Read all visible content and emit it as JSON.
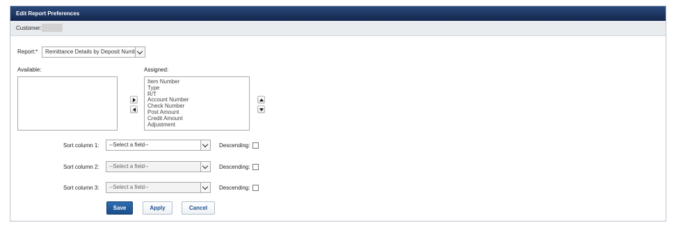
{
  "panel": {
    "title": "Edit Report Preferences"
  },
  "customer": {
    "label": "Customer:"
  },
  "report": {
    "label": "Report:*",
    "selected": "Remittance Details by Deposit Number"
  },
  "available": {
    "label": "Available:",
    "items": []
  },
  "assigned": {
    "label": "Assigned:",
    "items": [
      "Item Number",
      "Type",
      "R/T",
      "Account Number",
      "Check Number",
      "Post Amount",
      "Credit Amount",
      "Adjustment"
    ]
  },
  "sort": {
    "rows": [
      {
        "label": "Sort column 1:",
        "placeholder": "--Select a field--",
        "descending_label": "Descending:",
        "enabled": true
      },
      {
        "label": "Sort column 2:",
        "placeholder": "--Select a field--",
        "descending_label": "Descending:",
        "enabled": false
      },
      {
        "label": "Sort column 3:",
        "placeholder": "--Select a field--",
        "descending_label": "Descending:",
        "enabled": false
      }
    ]
  },
  "buttons": {
    "save": "Save",
    "apply": "Apply",
    "cancel": "Cancel"
  }
}
